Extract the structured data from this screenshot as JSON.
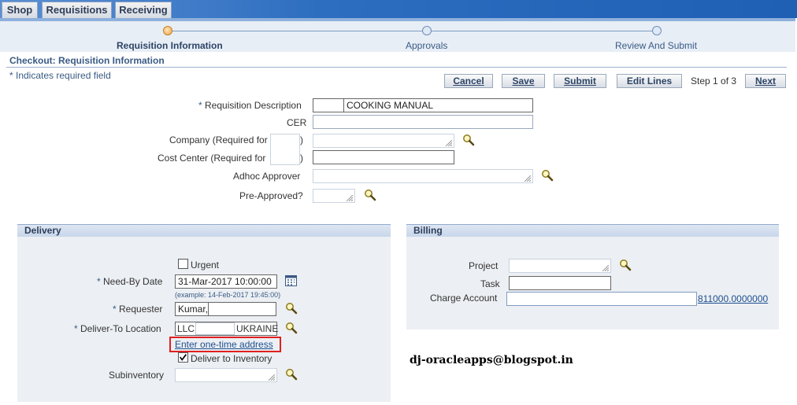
{
  "tabs": [
    "Shop",
    "Requisitions",
    "Receiving"
  ],
  "train": {
    "steps": [
      "Requisition Information",
      "Approvals",
      "Review And Submit"
    ]
  },
  "page": {
    "title": "Checkout: Requisition Information",
    "required_note": "* Indicates required field"
  },
  "buttons": {
    "cancel": "Cancel",
    "save": "Save",
    "submit": "Submit",
    "edit_lines": "Edit Lines",
    "next": "Next",
    "step_text": "Step 1 of 3"
  },
  "header_form": {
    "req_desc_label": "Requisition Description",
    "req_desc_value": "COOKING MANUAL",
    "cer_label": "CER",
    "company_label": "Company (Required for",
    "company_suffix": ")",
    "cost_center_label": "Cost Center (Required for",
    "cost_center_suffix": ")",
    "adhoc_label": "Adhoc Approver",
    "preapproved_label": "Pre-Approved?",
    "required_star": "*"
  },
  "delivery": {
    "title": "Delivery",
    "urgent_label": "Urgent",
    "need_by_label": "Need-By Date",
    "need_by_value": "31-Mar-2017 10:00:00",
    "need_by_hint": "(example: 14-Feb-2017 19:45:00)",
    "requester_label": "Requester",
    "requester_value": "Kumar,",
    "deliver_to_label": "Deliver-To Location",
    "deliver_to_prefix": "LLC",
    "deliver_to_suffix": "UKRAINE",
    "one_time_link": "Enter one-time address",
    "deliver_to_inventory_label": "Deliver to Inventory",
    "subinventory_label": "Subinventory",
    "required_star": "*"
  },
  "billing": {
    "title": "Billing",
    "project_label": "Project",
    "task_label": "Task",
    "charge_account_label": "Charge Account",
    "charge_account_link": "811000.0000000"
  },
  "watermark": "dj-oracleapps@blogspot.in",
  "colors": {
    "brand_blue": "#2e6ec0",
    "highlight_red": "#e02020",
    "link": "#1f4f8f"
  }
}
